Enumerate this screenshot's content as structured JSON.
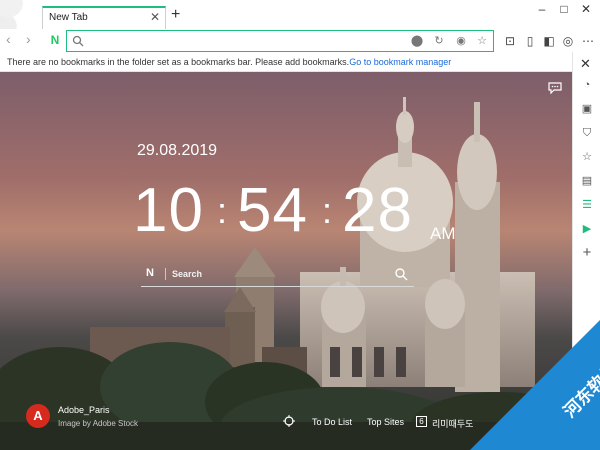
{
  "tab": {
    "title": "New Tab",
    "close_icon": "close-icon",
    "new_tab_icon": "plus-icon"
  },
  "window_controls": {
    "minimize": "–",
    "maximize": "□",
    "close": "✕"
  },
  "toolbar": {
    "back_icon": "back-arrow-icon",
    "forward_icon": "forward-arrow-icon",
    "logo": "N",
    "address_value": "",
    "icons": [
      "location-pin-icon",
      "refresh-icon",
      "screenshot-icon",
      "star-icon",
      "capture-icon",
      "info-icon",
      "split-view-icon",
      "profile-icon",
      "more-icon"
    ]
  },
  "bookmarks_bar": {
    "message": "There are no bookmarks in the folder set as a bookmarks bar. Please add bookmarks.",
    "link": "Go to bookmark manager"
  },
  "sidebar": {
    "items": [
      "close-icon",
      "search-icon",
      "gallery-icon",
      "shield-icon",
      "star-icon",
      "document-icon",
      "list-icon",
      "play-icon",
      "plus-icon"
    ],
    "accent": "#1fbd7d"
  },
  "newtab": {
    "date": "29.08.2019",
    "hours": "10",
    "minutes": "54",
    "seconds": "28",
    "ampm": "AM",
    "search_logo": "N",
    "search_placeholder": "Search",
    "photo_title": "Adobe_Paris",
    "photo_credit": "Image by Adobe Stock",
    "adobe_letter": "A",
    "links": {
      "todo": "To Do List",
      "top_sites": "Top Sites",
      "badge": "6",
      "korean": "리미때두도"
    }
  },
  "watermark": {
    "text": "河东软件"
  }
}
